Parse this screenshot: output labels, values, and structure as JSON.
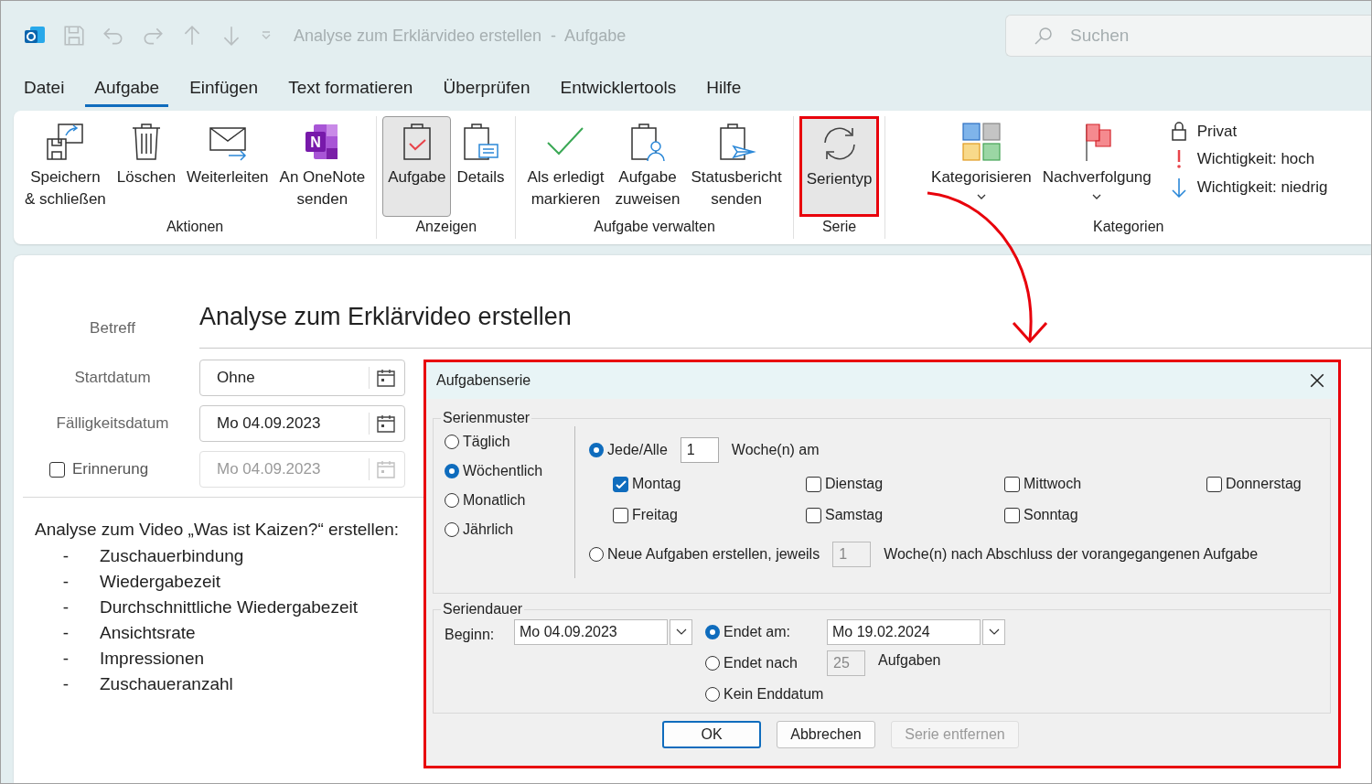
{
  "window": {
    "title": "Analyse zum Erklärvideo erstellen  -  Aufgabe"
  },
  "search": {
    "placeholder": "Suchen"
  },
  "menu_tabs": [
    {
      "label": "Datei",
      "selected": false
    },
    {
      "label": "Aufgabe",
      "selected": true
    },
    {
      "label": "Einfügen",
      "selected": false
    },
    {
      "label": "Text formatieren",
      "selected": false
    },
    {
      "label": "Überprüfen",
      "selected": false
    },
    {
      "label": "Entwicklertools",
      "selected": false
    },
    {
      "label": "Hilfe",
      "selected": false
    }
  ],
  "ribbon": {
    "groups": [
      {
        "label": "Aktionen",
        "buttons": [
          {
            "kind": "save-close",
            "label": "Speichern\n& schließen",
            "pressed": false,
            "marked": false
          },
          {
            "kind": "delete",
            "label": "Löschen",
            "pressed": false,
            "marked": false
          },
          {
            "kind": "forward",
            "label": "Weiterleiten",
            "pressed": false,
            "marked": false
          },
          {
            "kind": "onenote",
            "label": "An OneNote\nsenden",
            "icon_letter": "N",
            "pressed": false,
            "marked": false
          }
        ]
      },
      {
        "label": "Anzeigen",
        "buttons": [
          {
            "kind": "task",
            "label": "Aufgabe",
            "pressed": true,
            "marked": false
          },
          {
            "kind": "details",
            "label": "Details",
            "pressed": false,
            "marked": false
          }
        ]
      },
      {
        "label": "Aufgabe verwalten",
        "buttons": [
          {
            "kind": "complete",
            "label": "Als erledigt\nmarkieren",
            "pressed": false,
            "marked": false
          },
          {
            "kind": "assign",
            "label": "Aufgabe\nzuweisen",
            "pressed": false,
            "marked": false
          },
          {
            "kind": "status",
            "label": "Statusbericht\nsenden",
            "pressed": false,
            "marked": false
          }
        ]
      },
      {
        "label": "Serie",
        "buttons": [
          {
            "kind": "recurrence",
            "label": "Serientyp",
            "pressed": true,
            "marked": true
          }
        ]
      },
      {
        "label": "Kategorien",
        "buttons": [
          {
            "kind": "categorize",
            "label": "Kategorisieren",
            "has_menu": true,
            "pressed": false,
            "marked": false
          },
          {
            "kind": "followup",
            "label": "Nachverfolgung",
            "has_menu": true,
            "pressed": false,
            "marked": false
          }
        ],
        "small_buttons": [
          {
            "kind": "private",
            "label": "Privat"
          },
          {
            "kind": "high",
            "label": "Wichtigkeit: hoch"
          },
          {
            "kind": "low",
            "label": "Wichtigkeit: niedrig"
          }
        ]
      }
    ]
  },
  "form": {
    "subject_label": "Betreff",
    "subject": "Analyse zum Erklärvideo erstellen",
    "fields": [
      {
        "kind": "date",
        "label": "Startdatum",
        "value": "Ohne",
        "disabled": false
      },
      {
        "kind": "date",
        "label": "Fälligkeitsdatum",
        "value": "Mo 04.09.2023",
        "disabled": false
      },
      {
        "kind": "reminder",
        "label": "Erinnerung",
        "value": "Mo 04.09.2023",
        "disabled": true,
        "checked": false
      }
    ]
  },
  "body": {
    "intro": "Analyse zum Video „Was ist Kaizen?“ erstellen:",
    "items": [
      {
        "marker": "-",
        "text": "Zuschauerbindung"
      },
      {
        "marker": "-",
        "text": "Wiedergabezeit"
      },
      {
        "marker": "-",
        "text": "Durchschnittliche Wiedergabezeit"
      },
      {
        "marker": "-",
        "text": "Ansichtsrate"
      },
      {
        "marker": "-",
        "text": "Impressionen"
      },
      {
        "marker": "-",
        "text": "Zuschaueranzahl"
      }
    ]
  },
  "dialog": {
    "title": "Aufgabenserie",
    "marked": true,
    "pattern": {
      "legend": "Serienmuster",
      "frequencies": [
        {
          "label": "Täglich",
          "selected": false
        },
        {
          "label": "Wöchentlich",
          "selected": true
        },
        {
          "label": "Monatlich",
          "selected": false
        },
        {
          "label": "Jährlich",
          "selected": false
        }
      ],
      "every": {
        "label": "Jede/Alle",
        "selected": true,
        "value": "1",
        "unit": "Woche(n) am"
      },
      "days": [
        {
          "label": "Montag",
          "checked": true
        },
        {
          "label": "Dienstag",
          "checked": false
        },
        {
          "label": "Mittwoch",
          "checked": false
        },
        {
          "label": "Donnerstag",
          "checked": false
        },
        {
          "label": "Freitag",
          "checked": false
        },
        {
          "label": "Samstag",
          "checked": false
        },
        {
          "label": "Sonntag",
          "checked": false
        }
      ],
      "regenerate": {
        "label": "Neue Aufgaben erstellen, jeweils",
        "selected": false,
        "value": "1",
        "unit": "Woche(n) nach Abschluss der vorangegangenen Aufgabe"
      }
    },
    "range": {
      "legend": "Seriendauer",
      "start_label": "Beginn:",
      "start": "Mo 04.09.2023",
      "end_options": [
        {
          "kind": "date",
          "label": "Endet am:",
          "selected": true,
          "value": "Mo 19.02.2024"
        },
        {
          "kind": "count",
          "label": "Endet nach",
          "selected": false,
          "value": "25",
          "unit": "Aufgaben"
        },
        {
          "kind": "none",
          "label": "Kein Enddatum",
          "selected": false
        }
      ]
    },
    "buttons": [
      {
        "label": "OK",
        "default": true,
        "disabled": false
      },
      {
        "label": "Abbrechen",
        "default": false,
        "disabled": false
      },
      {
        "label": "Serie entfernen",
        "default": false,
        "disabled": true
      }
    ]
  }
}
